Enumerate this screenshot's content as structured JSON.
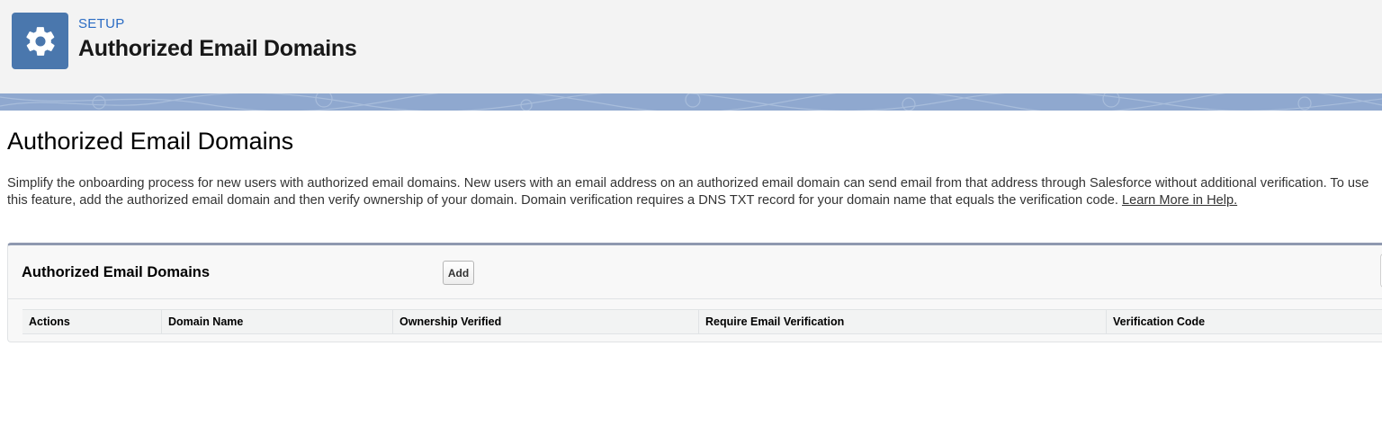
{
  "header": {
    "icon": "gear-icon",
    "eyebrow": "SETUP",
    "title": "Authorized Email Domains"
  },
  "page": {
    "title": "Authorized Email Domains",
    "description": "Simplify the onboarding process for new users with authorized email domains. New users with an email address on an authorized email domain can send email from that address through Salesforce without additional verification. To use this feature, add the authorized email domain and then verify ownership of your domain. Domain verification requires a DNS TXT record for your domain name that equals the verification code.",
    "help_link": "Learn More in Help."
  },
  "panel": {
    "title": "Authorized Email Domains",
    "add_label": "Add",
    "columns": [
      "Actions",
      "Domain Name",
      "Ownership Verified",
      "Require Email Verification",
      "Verification Code"
    ]
  },
  "colors": {
    "header_bg": "#f3f3f3",
    "setup_icon_bg": "#4a77ad",
    "eyebrow": "#2b6cc4",
    "banner": "#8fa8cf",
    "panel_top_border": "#8f99b0"
  }
}
